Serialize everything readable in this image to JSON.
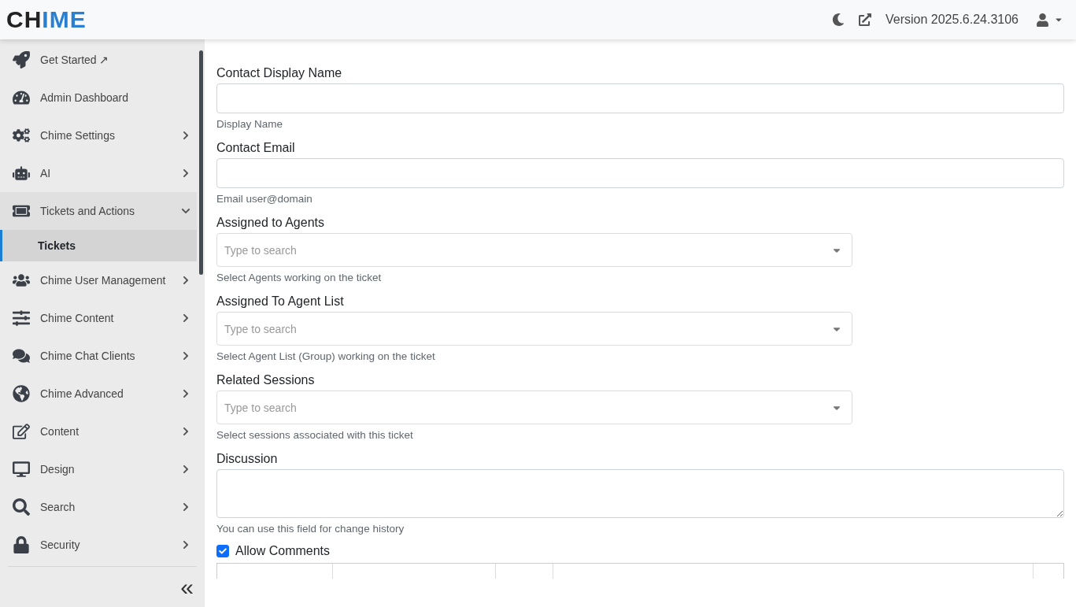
{
  "header": {
    "logo_dark": "CH",
    "logo_accent": "IME",
    "version": "Version 2025.6.24.3106"
  },
  "sidebar": {
    "items": [
      {
        "label": "Get Started ↗",
        "has_arrow": false
      },
      {
        "label": "Admin Dashboard",
        "has_arrow": false
      },
      {
        "label": "Chime Settings",
        "has_arrow": true,
        "expanded": false
      },
      {
        "label": "AI",
        "has_arrow": true,
        "expanded": false
      },
      {
        "label": "Tickets and Actions",
        "has_arrow": true,
        "expanded": true,
        "children": [
          {
            "label": "Tickets",
            "selected": true
          }
        ]
      },
      {
        "label": "Chime User Management",
        "has_arrow": true,
        "expanded": false
      },
      {
        "label": "Chime Content",
        "has_arrow": true,
        "expanded": false
      },
      {
        "label": "Chime Chat Clients",
        "has_arrow": true,
        "expanded": false
      },
      {
        "label": "Chime Advanced",
        "has_arrow": true,
        "expanded": false
      },
      {
        "label": "Content",
        "has_arrow": true,
        "expanded": false
      },
      {
        "label": "Design",
        "has_arrow": true,
        "expanded": false
      },
      {
        "label": "Search",
        "has_arrow": true,
        "expanded": false
      },
      {
        "label": "Security",
        "has_arrow": true,
        "expanded": false
      }
    ],
    "collapse": "«"
  },
  "form": {
    "fields": [
      {
        "kind": "text",
        "label": "Contact Display Name",
        "help": "Display Name"
      },
      {
        "kind": "text",
        "label": "Contact Email",
        "help": "Email user@domain"
      },
      {
        "kind": "select",
        "label": "Assigned to Agents",
        "placeholder": "Type to search",
        "help": "Select Agents working on the ticket"
      },
      {
        "kind": "select",
        "label": "Assigned To Agent List",
        "placeholder": "Type to search",
        "help": "Select Agent List (Group) working on the ticket"
      },
      {
        "kind": "select",
        "label": "Related Sessions",
        "placeholder": "Type to search",
        "help": "Select sessions associated with this ticket"
      },
      {
        "kind": "textarea",
        "label": "Discussion",
        "help": "You can use this field for change history"
      }
    ],
    "allow_comments": {
      "label": "Allow Comments",
      "checked": true
    }
  }
}
